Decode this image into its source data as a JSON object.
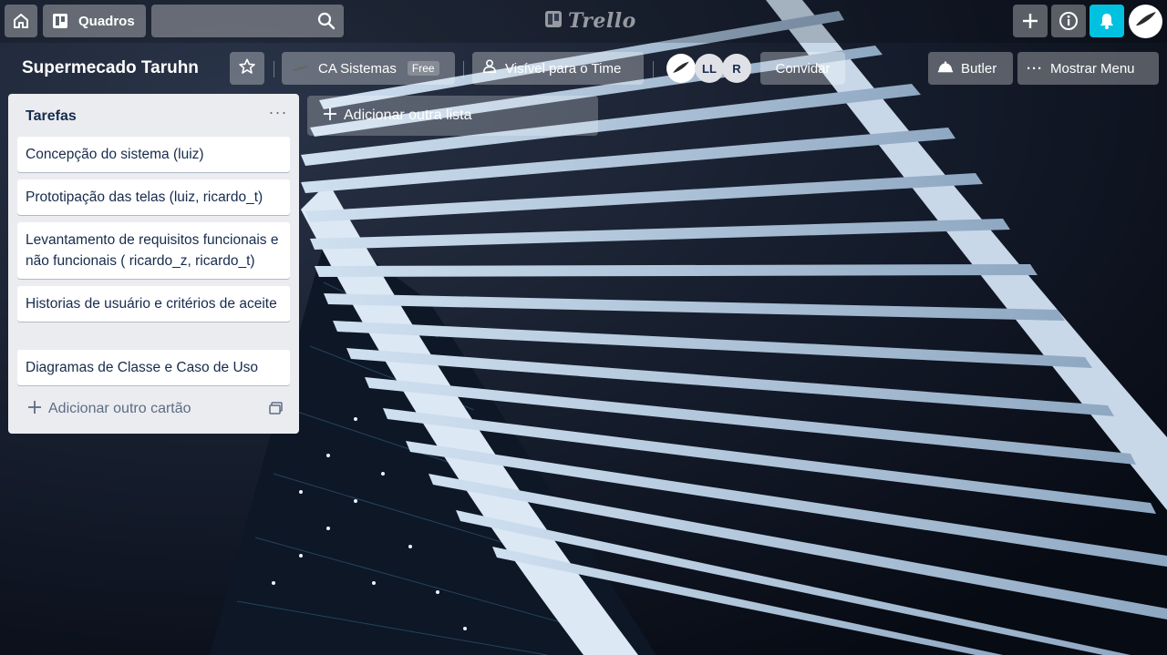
{
  "header": {
    "boards_label": "Quadros",
    "search_value": "",
    "logo_text": "Trello"
  },
  "board": {
    "title": "Supermecado Taruhn",
    "team_name": "CA Sistemas",
    "team_plan": "Free",
    "visibility": "Visível para o Time",
    "members": [
      "LL",
      "R"
    ],
    "invite_label": "Convidar",
    "butler_label": "Butler",
    "menu_label": "Mostrar Menu"
  },
  "list": {
    "title": "Tarefas",
    "menu_glyph": "···",
    "cards": [
      "Concepção do sistema (luiz)",
      "Prototipação das telas (luiz, ricardo_t)",
      "Levantamento de requisitos funcionais e não funcionais ( ricardo_z, ricardo_t)",
      "Historias de usuário e critérios de aceite",
      "Diagramas de Classe e Caso de Uso"
    ],
    "add_card_label": "Adicionar outro cartão"
  },
  "add_list_label": "Adicionar outra lista",
  "colors": {
    "notification_button": "#00c2e0",
    "list_bg": "#ebecf0",
    "card_text": "#172b4d"
  },
  "icons": [
    "home-icon",
    "board-icon",
    "search-icon",
    "plus-icon",
    "info-icon",
    "bell-icon",
    "star-icon",
    "team-icon",
    "visibility-icon",
    "butler-icon",
    "more-icon",
    "template-icon"
  ]
}
